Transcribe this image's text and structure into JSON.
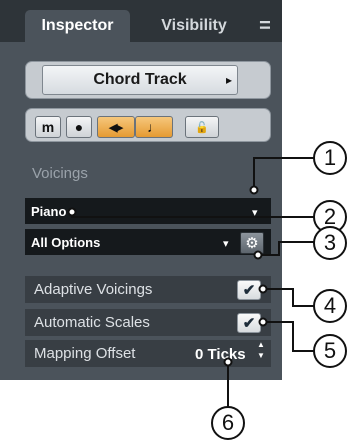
{
  "tabs": {
    "inspector": "Inspector",
    "visibility": "Visibility",
    "menu_glyph": "="
  },
  "track": {
    "name": "Chord Track",
    "arrow_glyph": "▸"
  },
  "buttons": {
    "mute": "m",
    "record": "●",
    "monitor": "◀▸",
    "note": "♩",
    "lock": "🔓"
  },
  "voicings": {
    "section_label": "Voicings",
    "voicing_value": "Piano",
    "voicing_arrow": "▾",
    "options_value": "All Options",
    "options_arrow": "▾",
    "gear_glyph": "⚙"
  },
  "settings": {
    "adaptive_label": "Adaptive Voicings",
    "adaptive_checked": true,
    "scales_label": "Automatic Scales",
    "scales_checked": true,
    "offset_label": "Mapping Offset",
    "offset_value": "0 Ticks",
    "check_glyph": "✔",
    "spin_up": "▲",
    "spin_down": "▼"
  },
  "callouts": [
    "1",
    "2",
    "3",
    "4",
    "5",
    "6"
  ],
  "colors": {
    "panel": "#4b535b",
    "tabbar": "#2e3439",
    "accent_orange": "#e59a32",
    "dark_field": "#15191c"
  }
}
